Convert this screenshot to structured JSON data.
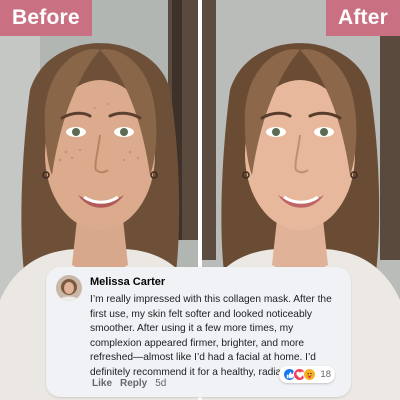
{
  "labels": {
    "before": "Before",
    "after": "After"
  },
  "comment": {
    "author": "Melissa Carter",
    "text": "I’m really impressed with this collagen mask. After the first use, my skin felt softer and looked noticeably smoother. After using it a few more times, my complexion appeared firmer, brighter, and more refreshed—almost like I’d had a facial at home. I’d definitely recommend it for a healthy, radiant glow!",
    "actions": {
      "like": "Like",
      "reply": "Reply",
      "time": "5d"
    },
    "reactions": {
      "icons": [
        "like-icon",
        "love-icon",
        "care-icon"
      ],
      "count": "18"
    }
  },
  "colors": {
    "label_bg": "#c97183",
    "like": "#1877f2",
    "love": "#f33e58",
    "care": "#f7b125"
  }
}
